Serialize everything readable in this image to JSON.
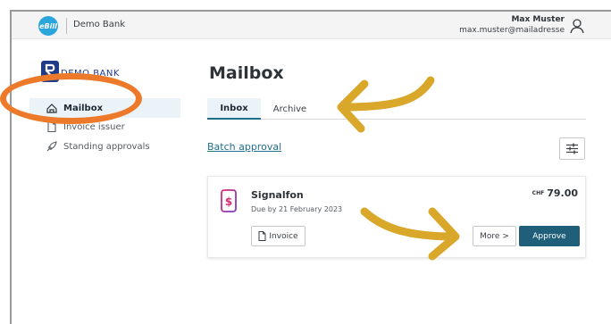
{
  "topbar": {
    "logo_text": "eBill",
    "bank_name": "Demo Bank",
    "user_name": "Max Muster",
    "user_email": "max.muster@mailadresse"
  },
  "sidebar": {
    "logo_text": "DEMO BANK",
    "items": [
      {
        "label": "Mailbox",
        "active": true
      },
      {
        "label": "Invoice issuer",
        "active": false
      },
      {
        "label": "Standing approvals",
        "active": false
      }
    ]
  },
  "main": {
    "title": "Mailbox",
    "tabs": [
      {
        "label": "Inbox",
        "active": true
      },
      {
        "label": "Archive",
        "active": false
      }
    ],
    "batch_link": "Batch approval"
  },
  "invoice": {
    "issuer": "Signalfon",
    "due": "Due by 21 February 2023",
    "currency": "CHF",
    "amount": "79.00",
    "invoice_button": "Invoice",
    "more_button": "More >",
    "approve_button": "Approve"
  },
  "colors": {
    "accent": "#1f5f7a",
    "highlight_ring": "#ec7a2a",
    "arrow": "#d9a72a",
    "ebill_logo": "#2aa6dc"
  }
}
